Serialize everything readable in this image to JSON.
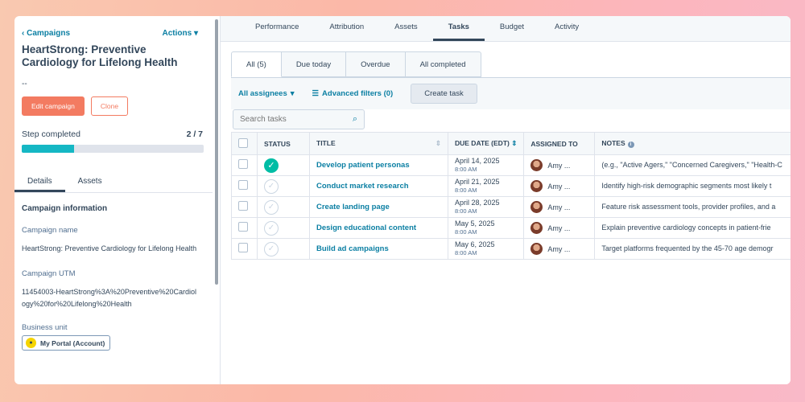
{
  "campaign": {
    "back_label": "Campaigns",
    "actions_label": "Actions",
    "title": "HeartStrong: Preventive Cardiology for Lifelong Health",
    "dash": "--",
    "edit_label": "Edit campaign",
    "clone_label": "Clone",
    "step_label": "Step completed",
    "step_count": "2 / 7",
    "step_progress": 0.286
  },
  "left_tabs": [
    {
      "label": "Details"
    },
    {
      "label": "Assets"
    }
  ],
  "info": {
    "section_title": "Campaign information",
    "name_label": "Campaign name",
    "name_value": "HeartStrong: Preventive Cardiology for Lifelong Health",
    "utm_label": "Campaign UTM",
    "utm_value": "11454003-HeartStrong%3A%20Preventive%20Cardiology%20for%20Lifelong%20Health",
    "bu_label": "Business unit",
    "bu_value": "My Portal (Account)"
  },
  "top_tabs": [
    {
      "label": "Performance"
    },
    {
      "label": "Attribution"
    },
    {
      "label": "Assets"
    },
    {
      "label": "Tasks"
    },
    {
      "label": "Budget"
    },
    {
      "label": "Activity"
    }
  ],
  "sub_tabs": [
    {
      "label": "All (5)"
    },
    {
      "label": "Due today"
    },
    {
      "label": "Overdue"
    },
    {
      "label": "All completed"
    }
  ],
  "filters": {
    "assignees_label": "All assignees",
    "advanced_label": "Advanced filters (0)",
    "create_label": "Create task",
    "search_placeholder": "Search tasks"
  },
  "table": {
    "headers": {
      "status": "STATUS",
      "title": "TITLE",
      "due": "DUE DATE (EDT)",
      "assigned": "ASSIGNED TO",
      "notes": "NOTES"
    },
    "rows": [
      {
        "title": "Develop patient personas",
        "date": "April 14, 2025",
        "time": "8:00 AM",
        "assignee": "Amy ...",
        "notes": "(e.g., \"Active Agers,\" \"Concerned Caregivers,\" \"Health-C",
        "done": true
      },
      {
        "title": "Conduct market research",
        "date": "April 21, 2025",
        "time": "8:00 AM",
        "assignee": "Amy ...",
        "notes": "Identify high-risk demographic segments most likely t",
        "done": false
      },
      {
        "title": "Create landing page",
        "date": "April 28, 2025",
        "time": "8:00 AM",
        "assignee": "Amy ...",
        "notes": "Feature risk assessment tools, provider profiles, and a",
        "done": false
      },
      {
        "title": "Design educational content",
        "date": "May 5, 2025",
        "time": "8:00 AM",
        "assignee": "Amy ...",
        "notes": "Explain preventive cardiology concepts in patient-frie",
        "done": false
      },
      {
        "title": "Build ad campaigns",
        "date": "May 6, 2025",
        "time": "8:00 AM",
        "assignee": "Amy ...",
        "notes": "Target platforms frequented by the 45-70 age demogr",
        "done": false
      }
    ]
  }
}
